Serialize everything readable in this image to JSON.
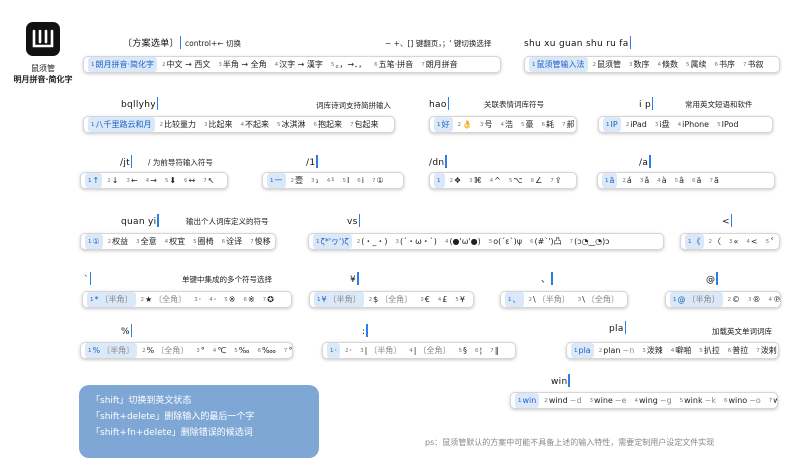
{
  "app": {
    "name": "鼠须管",
    "variant": "明月拼音·简化字"
  },
  "examples": [
    {
      "id": "menu",
      "input": "〔方案选单〕",
      "notes": [
        {
          "text": "control+← 切换"
        },
        {
          "text": "− +、[] 键翻页，；' 键切换选择"
        }
      ],
      "candidates": [
        {
          "n": "1",
          "t": "朗月拼音·简化字",
          "sel": true
        },
        {
          "n": "2",
          "t": "中文 → 西文"
        },
        {
          "n": "3",
          "t": "半角 → 全角"
        },
        {
          "n": "4",
          "t": "汉字 → 漢字"
        },
        {
          "n": "5",
          "t": "。，→．，"
        },
        {
          "n": "6",
          "t": "五笔·拼音"
        },
        {
          "n": "7",
          "t": "朗月拼音"
        }
      ]
    },
    {
      "id": "shuxu",
      "input": "shu xu guan shu ru fa",
      "notes": [],
      "candidates": [
        {
          "n": "1",
          "t": "鼠须管输入法",
          "sel": true
        },
        {
          "n": "2",
          "t": "鼠须管"
        },
        {
          "n": "3",
          "t": "数序"
        },
        {
          "n": "4",
          "t": "倏数"
        },
        {
          "n": "5",
          "t": "属续"
        },
        {
          "n": "6",
          "t": "书序"
        },
        {
          "n": "7",
          "t": "书叙"
        }
      ]
    },
    {
      "id": "bqllyhy",
      "input": "bqllyhy",
      "notes": [
        {
          "text": "词库诗词支持简拼输入"
        }
      ],
      "candidates": [
        {
          "n": "1",
          "t": "八千里路云和月",
          "sel": true
        },
        {
          "n": "2",
          "t": "比较量力"
        },
        {
          "n": "3",
          "t": "比起来"
        },
        {
          "n": "4",
          "t": "不起来"
        },
        {
          "n": "5",
          "t": "冰淇淋"
        },
        {
          "n": "6",
          "t": "抱起来"
        },
        {
          "n": "7",
          "t": "包起来"
        }
      ]
    },
    {
      "id": "hao",
      "input": "hao",
      "notes": [
        {
          "text": "关联表情词库符号"
        }
      ],
      "candidates": [
        {
          "n": "1",
          "t": "好",
          "sel": true
        },
        {
          "n": "2",
          "t": "👌"
        },
        {
          "n": "3",
          "t": "号"
        },
        {
          "n": "4",
          "t": "浩"
        },
        {
          "n": "5",
          "t": "豪"
        },
        {
          "n": "6",
          "t": "耗"
        },
        {
          "n": "7",
          "t": "郝"
        }
      ]
    },
    {
      "id": "ip",
      "input": "i p",
      "notes": [
        {
          "text": "常用英文短语和软件"
        }
      ],
      "candidates": [
        {
          "n": "1",
          "t": "IP",
          "sel": true
        },
        {
          "n": "2",
          "t": "iPad"
        },
        {
          "n": "3",
          "t": "i盘"
        },
        {
          "n": "4",
          "t": "iPhone"
        },
        {
          "n": "5",
          "t": "IPod"
        }
      ]
    },
    {
      "id": "jt",
      "input": "/jt",
      "notes": [
        {
          "text": "/ 为前导符输入符号"
        }
      ],
      "candidates": [
        {
          "n": "1",
          "t": "↑",
          "sel": true
        },
        {
          "n": "2",
          "t": "↓"
        },
        {
          "n": "3",
          "t": "←"
        },
        {
          "n": "4",
          "t": "→"
        },
        {
          "n": "5",
          "t": "⬇"
        },
        {
          "n": "6",
          "t": "↔"
        },
        {
          "n": "7",
          "t": "↖"
        }
      ]
    },
    {
      "id": "slash1",
      "input": "/1",
      "notes": [],
      "candidates": [
        {
          "n": "1",
          "t": "一",
          "sel": true
        },
        {
          "n": "2",
          "t": "壹"
        },
        {
          "n": "3",
          "t": "₁"
        },
        {
          "n": "4",
          "t": "¹"
        },
        {
          "n": "5",
          "t": "Ⅰ"
        },
        {
          "n": "6",
          "t": "ⅰ"
        },
        {
          "n": "7",
          "t": "①"
        }
      ]
    },
    {
      "id": "dn",
      "input": "/dn",
      "notes": [],
      "candidates": [
        {
          "n": "1",
          "t": "",
          "sel": true
        },
        {
          "n": "2",
          "t": "❖"
        },
        {
          "n": "3",
          "t": "⌘"
        },
        {
          "n": "4",
          "t": "^"
        },
        {
          "n": "5",
          "t": "⌥"
        },
        {
          "n": "6",
          "t": "∠"
        },
        {
          "n": "7",
          "t": "⇪"
        }
      ]
    },
    {
      "id": "slasha",
      "input": "/a",
      "notes": [],
      "candidates": [
        {
          "n": "1",
          "t": "ā",
          "sel": true
        },
        {
          "n": "2",
          "t": "á"
        },
        {
          "n": "3",
          "t": "ǎ"
        },
        {
          "n": "4",
          "t": "à"
        },
        {
          "n": "5",
          "t": "â"
        },
        {
          "n": "6",
          "t": "ä"
        },
        {
          "n": "7",
          "t": "ã"
        }
      ]
    },
    {
      "id": "quanyi",
      "input": "quan yi",
      "notes": [
        {
          "text": "输出个人词库定义的符号"
        }
      ],
      "candidates": [
        {
          "n": "1",
          "t": "①",
          "sel": true
        },
        {
          "n": "2",
          "t": "权益"
        },
        {
          "n": "3",
          "t": "全意"
        },
        {
          "n": "4",
          "t": "权宜"
        },
        {
          "n": "5",
          "t": "圈椅"
        },
        {
          "n": "6",
          "t": "诠译"
        },
        {
          "n": "7",
          "t": "悛移"
        }
      ]
    },
    {
      "id": "vs",
      "input": "vs",
      "notes": [],
      "candidates": [
        {
          "n": "1",
          "t": "ζ*'ヮ')ζ",
          "sel": true
        },
        {
          "n": "2",
          "t": "(・_・)"
        },
        {
          "n": "3",
          "t": "(´・ω・`)"
        },
        {
          "n": "4",
          "t": "(●'ω'●)"
        },
        {
          "n": "5",
          "t": "o(´ε`)ψ"
        },
        {
          "n": "6",
          "t": "(#`')凸"
        },
        {
          "n": "7",
          "t": "(ɔ◔‿◔)ɔ"
        }
      ]
    },
    {
      "id": "lessthan",
      "input": "<",
      "notes": [],
      "candidates": [
        {
          "n": "1",
          "t": "《",
          "sel": true
        },
        {
          "n": "2",
          "t": "〈"
        },
        {
          "n": "3",
          "t": "«"
        },
        {
          "n": "4",
          "t": "<"
        },
        {
          "n": "5",
          "t": "˂"
        },
        {
          "n": "6",
          "t": "。"
        }
      ]
    },
    {
      "id": "grave",
      "input": "`",
      "notes": [
        {
          "text": "单键中集成的多个符号选择"
        }
      ],
      "candidates": [
        {
          "n": "1",
          "t": "*",
          "c": "〔半角〕",
          "sel": true
        },
        {
          "n": "2",
          "t": "★",
          "c": "〔全角〕"
        },
        {
          "n": "3",
          "t": "·"
        },
        {
          "n": "4",
          "t": "·"
        },
        {
          "n": "5",
          "t": "※"
        },
        {
          "n": "6",
          "t": "※"
        },
        {
          "n": "7",
          "t": "✪"
        }
      ]
    },
    {
      "id": "yen",
      "input": "¥",
      "notes": [],
      "candidates": [
        {
          "n": "1",
          "t": "¥",
          "c": "〔半角〕",
          "sel": true
        },
        {
          "n": "2",
          "t": "$",
          "c": "〔全角〕"
        },
        {
          "n": "3",
          "t": "€"
        },
        {
          "n": "4",
          "t": "£"
        },
        {
          "n": "5",
          "t": "¥"
        },
        {
          "n": "6",
          "t": "¢"
        },
        {
          "n": "7",
          "t": "¤"
        }
      ]
    },
    {
      "id": "backslash",
      "input": "、",
      "notes": [],
      "candidates": [
        {
          "n": "1",
          "t": "、",
          "sel": true
        },
        {
          "n": "2",
          "t": "\\",
          "c": "〔半角〕"
        },
        {
          "n": "3",
          "t": "\\",
          "c": "〔全角〕"
        }
      ]
    },
    {
      "id": "at",
      "input": "@",
      "notes": [],
      "candidates": [
        {
          "n": "1",
          "t": "@",
          "c": "〔半角〕",
          "sel": true
        },
        {
          "n": "2",
          "t": "©"
        },
        {
          "n": "3",
          "t": "®"
        },
        {
          "n": "4",
          "t": "℗"
        }
      ]
    },
    {
      "id": "percent",
      "input": "%",
      "notes": [],
      "candidates": [
        {
          "n": "1",
          "t": "%",
          "c": "〔半角〕",
          "sel": true
        },
        {
          "n": "2",
          "t": "%",
          "c": "〔全角〕"
        },
        {
          "n": "3",
          "t": "°"
        },
        {
          "n": "4",
          "t": "℃"
        },
        {
          "n": "5",
          "t": "‰"
        },
        {
          "n": "6",
          "t": "‱"
        },
        {
          "n": "7",
          "t": "℉"
        }
      ]
    },
    {
      "id": "colon",
      "input": ":",
      "notes": [],
      "candidates": [
        {
          "n": "1",
          "t": "·",
          "sel": true
        },
        {
          "n": "2",
          "t": "·"
        },
        {
          "n": "3",
          "t": "|",
          "c": "〔半角〕"
        },
        {
          "n": "4",
          "t": "|",
          "c": "〔全角〕"
        },
        {
          "n": "5",
          "t": "§"
        },
        {
          "n": "6",
          "t": "¦"
        },
        {
          "n": "7",
          "t": "‖"
        }
      ]
    },
    {
      "id": "pla",
      "input": "pla",
      "notes": [
        {
          "text": "加载英文单词词库"
        }
      ],
      "candidates": [
        {
          "n": "1",
          "t": "pla",
          "sel": true
        },
        {
          "n": "2",
          "t": "plan",
          "c": "~n"
        },
        {
          "n": "3",
          "t": "泼辣"
        },
        {
          "n": "4",
          "t": "噼啪"
        },
        {
          "n": "5",
          "t": "扒拉"
        },
        {
          "n": "6",
          "t": "普拉"
        },
        {
          "n": "7",
          "t": "泼剌"
        }
      ]
    },
    {
      "id": "win",
      "input": "win",
      "notes": [],
      "candidates": [
        {
          "n": "1",
          "t": "win",
          "sel": true
        },
        {
          "n": "2",
          "t": "wind",
          "c": "~d"
        },
        {
          "n": "3",
          "t": "wine",
          "c": "~e"
        },
        {
          "n": "4",
          "t": "wing",
          "c": "~g"
        },
        {
          "n": "5",
          "t": "wink",
          "c": "~k"
        },
        {
          "n": "6",
          "t": "wino",
          "c": "~o"
        },
        {
          "n": "7",
          "t": "winy",
          "c": "~y"
        }
      ]
    }
  ],
  "shortcuts": [
    {
      "text": "「shift」切换到英文状态"
    },
    {
      "text": "「shift+delete」删除输入的最后一个字"
    },
    {
      "text": "「shift+fn+delete」删除错误的候选词"
    }
  ],
  "footnote": "ps：鼠须管默认的方案中可能不具备上述的输入特性，需要定制用户设定文件实现",
  "colors": {
    "accent": "#1a62c7",
    "highlight": "#dbe8f7",
    "infobox": "#7ea7d6",
    "caret": "#2b7de9"
  }
}
